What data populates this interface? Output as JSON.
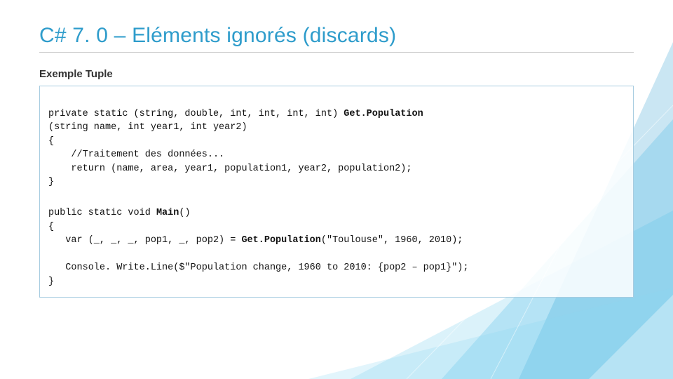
{
  "title": "C# 7. 0 – Eléments ignorés (discards)",
  "subtitle": "Exemple Tuple",
  "code": {
    "block1_line1a": "private static (string, double, int, int, int, int) ",
    "block1_line1b": "Get.Population",
    "block1_line2": "(string name, int year1, int year2)",
    "block1_line3": "{",
    "block1_line4": "    //Traitement des données...",
    "block1_line5": "    return (name, area, year1, population1, year2, population2);",
    "block1_line6": "}",
    "block2_line1a": "public static void ",
    "block2_line1b": "Main",
    "block2_line1c": "()",
    "block2_line2": "{",
    "block2_line3a": "   var (_, _, _, pop1, _, pop2) = ",
    "block2_line3b": "Get.Population",
    "block2_line3c": "(\"Toulouse\", 1960, 2010);",
    "block2_blank": "",
    "block2_line4": "   Console. Write.Line($\"Population change, 1960 to 2010: {pop2 – pop1}\");",
    "block2_line5": "}"
  }
}
